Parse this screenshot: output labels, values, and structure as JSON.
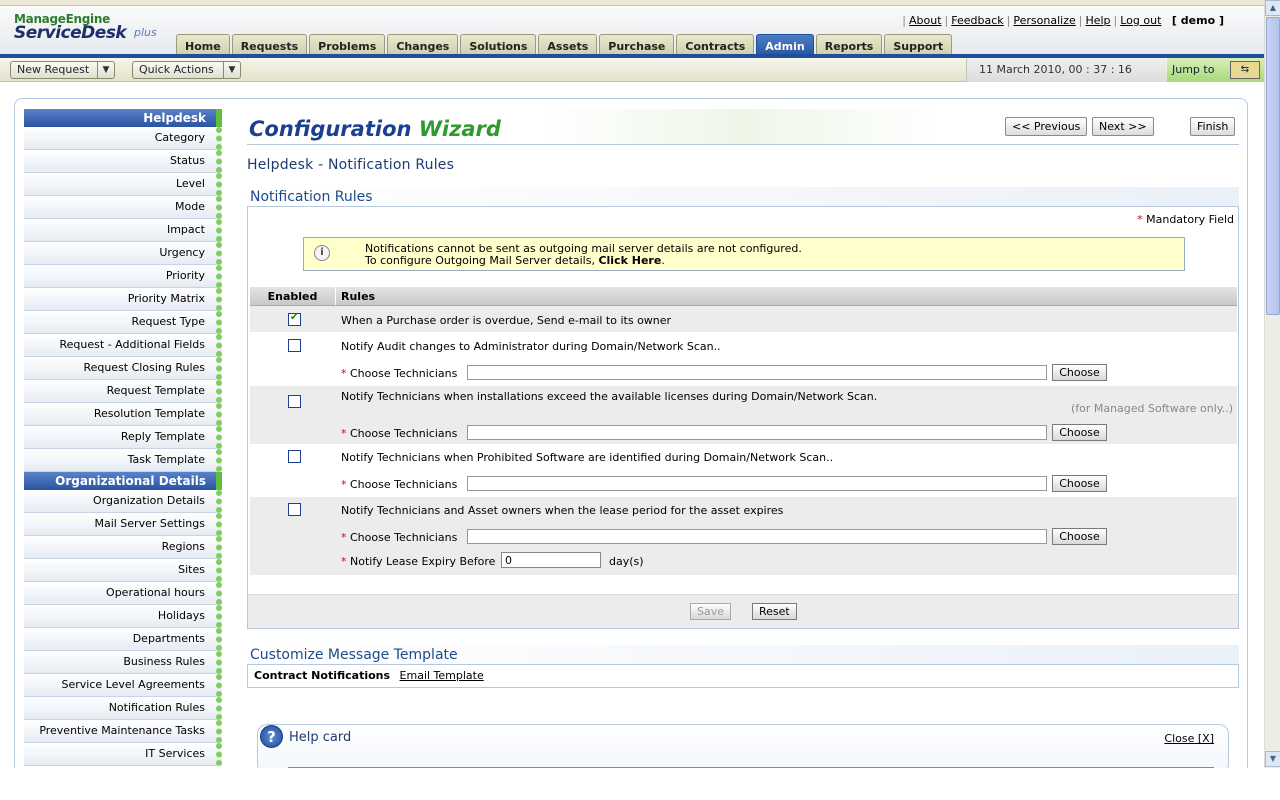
{
  "header": {
    "logo_top": "ManageEngine",
    "logo_main": "ServiceDesk",
    "logo_plus": "plus",
    "links": [
      "About",
      "Feedback",
      "Personalize",
      "Help",
      "Log out"
    ],
    "user": "[ demo ]",
    "tabs": [
      "Home",
      "Requests",
      "Problems",
      "Changes",
      "Solutions",
      "Assets",
      "Purchase",
      "Contracts",
      "Admin",
      "Reports",
      "Support"
    ],
    "active_tab": "Admin"
  },
  "actionbar": {
    "new_request": "New Request",
    "quick_actions": "Quick Actions",
    "datetime": "11 March 2010, 00 : 37 : 16",
    "jump_to": "Jump to"
  },
  "sidebar": {
    "section1": "Helpdesk",
    "items1": [
      "Category",
      "Status",
      "Level",
      "Mode",
      "Impact",
      "Urgency",
      "Priority",
      "Priority Matrix",
      "Request Type",
      "Request - Additional Fields",
      "Request Closing Rules",
      "Request Template",
      "Resolution Template",
      "Reply Template",
      "Task Template"
    ],
    "section2": "Organizational Details",
    "items2": [
      "Organization Details",
      "Mail Server Settings",
      "Regions",
      "Sites",
      "Operational hours",
      "Holidays",
      "Departments",
      "Business Rules",
      "Service Level Agreements",
      "Notification Rules",
      "Preventive Maintenance Tasks",
      "IT Services"
    ]
  },
  "wizard": {
    "title_a": "Configuration",
    "title_b": "Wizard",
    "prev": "<< Previous",
    "next": "Next >>",
    "finish": "Finish",
    "subtitle": "Helpdesk - Notification Rules"
  },
  "notif": {
    "section_title": "Notification Rules",
    "mandatory": "Mandatory Field",
    "info_line1": "Notifications cannot be sent as outgoing mail server details are not configured.",
    "info_line2": "To configure Outgoing Mail Server details,",
    "info_link": "Click Here",
    "col_enabled": "Enabled",
    "col_rules": "Rules",
    "rule1": "When a Purchase order is overdue, Send e-mail to its owner",
    "rule2": "Notify Audit changes to Administrator during Domain/Network Scan..",
    "rule3": "Notify Technicians when installations exceed the available licenses during Domain/Network Scan.",
    "rule3_note": "(for Managed Software only..)",
    "rule4": "Notify Technicians when Prohibited Software are identified during Domain/Network Scan..",
    "rule5": "Notify Technicians and Asset owners when the lease period for the asset expires",
    "choose_label": "Choose Technicians",
    "choose_btn": "Choose",
    "lease_label": "Notify Lease Expiry Before",
    "lease_value": "0",
    "lease_unit": "day(s)",
    "save": "Save",
    "reset": "Reset"
  },
  "cmt": {
    "title": "Customize Message Template",
    "label": "Contract Notifications",
    "link": "Email Template"
  },
  "help": {
    "title": "Help card",
    "close": "Close  [X]"
  }
}
